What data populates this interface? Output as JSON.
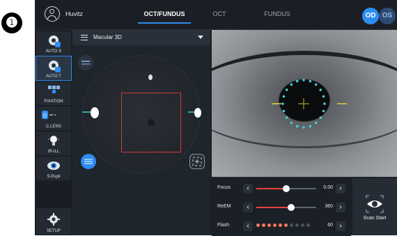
{
  "marker": "❶",
  "header": {
    "brand": "Huvitz",
    "tabs": [
      {
        "label": "OCT/FUNDUS",
        "active": true
      },
      {
        "label": "OCT",
        "active": false
      },
      {
        "label": "FUNDUS",
        "active": false
      }
    ],
    "eye_left": "OD",
    "eye_right": "OS",
    "accent": "#2d8cf0"
  },
  "sidebar": {
    "items": [
      {
        "label": "AUTO S",
        "icon": "auto-s-icon"
      },
      {
        "label": "AUTO T",
        "icon": "auto-t-icon",
        "active": true
      },
      {
        "label": "FIXATION",
        "icon": "fixation-icon"
      },
      {
        "label": "C.LENS",
        "icon": "c-lens-icon"
      },
      {
        "label": "IR-ILL",
        "icon": "ir-ill-icon"
      },
      {
        "label": "S.Pupil",
        "icon": "s-pupil-icon"
      }
    ],
    "setup_label": "SETUP"
  },
  "scan_panel": {
    "mode": "Macular 3D",
    "box_color": "#d13a3a"
  },
  "controls": {
    "focus": {
      "label": "Focus",
      "value": "0.00",
      "fraction": 0.5
    },
    "relm": {
      "label": "ReEM",
      "value": "360",
      "fraction": 0.58
    },
    "flash": {
      "label": "Flash",
      "value": "60",
      "fraction": 0.6,
      "dots_total": 10,
      "dots_on": 6
    }
  },
  "scan_button": {
    "label": "Scan Start"
  }
}
